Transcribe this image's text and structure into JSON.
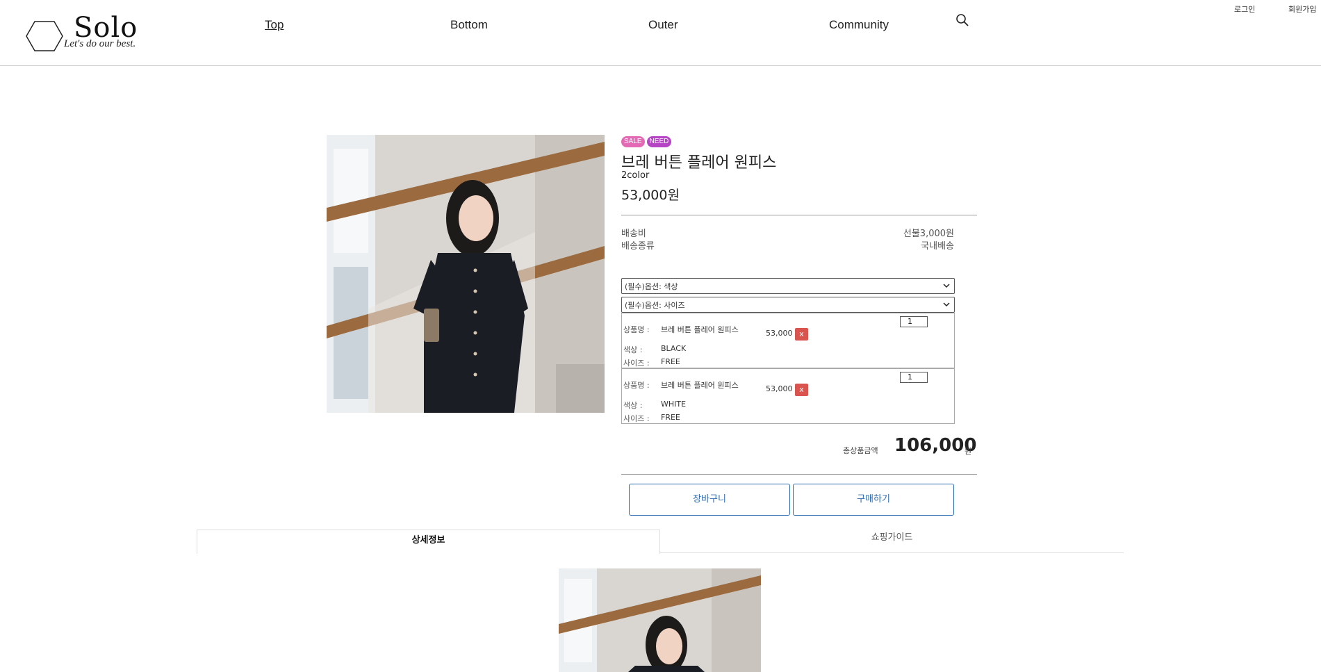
{
  "header": {
    "logo_title": "Solo",
    "logo_subtitle": "Let's do our best.",
    "nav": [
      "Top",
      "Bottom",
      "Outer",
      "Community"
    ],
    "login": "로그인",
    "signup": "회원가입"
  },
  "product": {
    "badges": [
      "SALE",
      "NEED"
    ],
    "name": "브레 버튼 플레어 원피스",
    "color_count": "2color",
    "price": "53,000원",
    "shipping_fee_label": "배송비",
    "shipping_fee_value": "선불3,000원",
    "shipping_type_label": "배송종류",
    "shipping_type_value": "국내배송",
    "select_color": "(필수)옵션: 색상",
    "select_size": "(필수)옵션: 사이즈"
  },
  "selected_options": [
    {
      "name_label": "상품명 :",
      "name": "브레 버튼 플레어 원피스",
      "price": "53,000",
      "delete": "x",
      "qty": "1",
      "color_label": "색상 :",
      "color": "BLACK",
      "size_label": "사이즈 :",
      "size": "FREE"
    },
    {
      "name_label": "상품명 :",
      "name": "브레 버튼 플레어 원피스",
      "price": "53,000",
      "delete": "x",
      "qty": "1",
      "color_label": "색상 :",
      "color": "WHITE",
      "size_label": "사이즈 :",
      "size": "FREE"
    }
  ],
  "total": {
    "label": "총상품금액",
    "amount": "106,000",
    "unit": "원"
  },
  "buttons": {
    "cart": "장바구니",
    "buy": "구매하기"
  },
  "tabs": {
    "detail": "상세정보",
    "guide": "쇼핑가이드"
  },
  "colors": {
    "accent": "#2c6bb0",
    "sale_badge": "#e36bb5",
    "need_badge": "#b545c4",
    "delete": "#d9534f"
  }
}
